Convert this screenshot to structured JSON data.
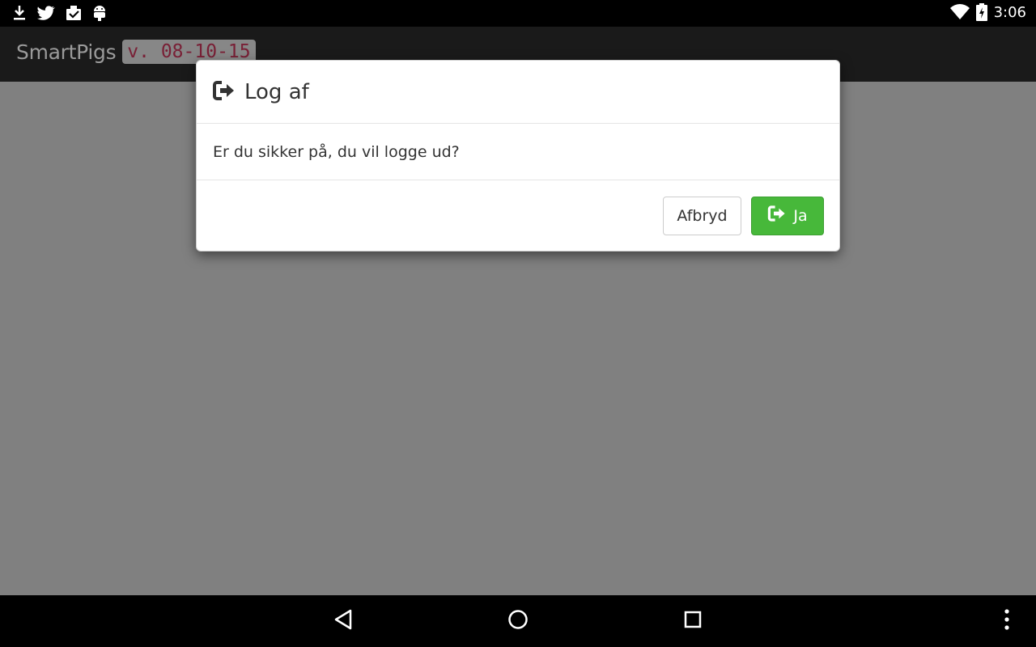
{
  "status_bar": {
    "time": "3:06",
    "left_icons": [
      "download-icon",
      "twitter-icon",
      "clipboard-check-icon",
      "android-icon"
    ],
    "right_icons": [
      "wifi-icon",
      "battery-charging-icon"
    ]
  },
  "app_bar": {
    "title": "SmartPigs",
    "version": "v. 08-10-15"
  },
  "dialog": {
    "title": "Log af",
    "title_icon": "logout-icon",
    "message": "Er du sikker på, du vil logge ud?",
    "cancel_label": "Afbryd",
    "confirm_label": "Ja",
    "confirm_icon": "logout-icon"
  },
  "nav_bar": {
    "buttons": [
      "back-icon",
      "home-icon",
      "recents-icon",
      "overflow-menu-icon"
    ]
  },
  "colors": {
    "success": "#47b83a",
    "overlay": "#808080",
    "version_text": "#c7254e"
  }
}
